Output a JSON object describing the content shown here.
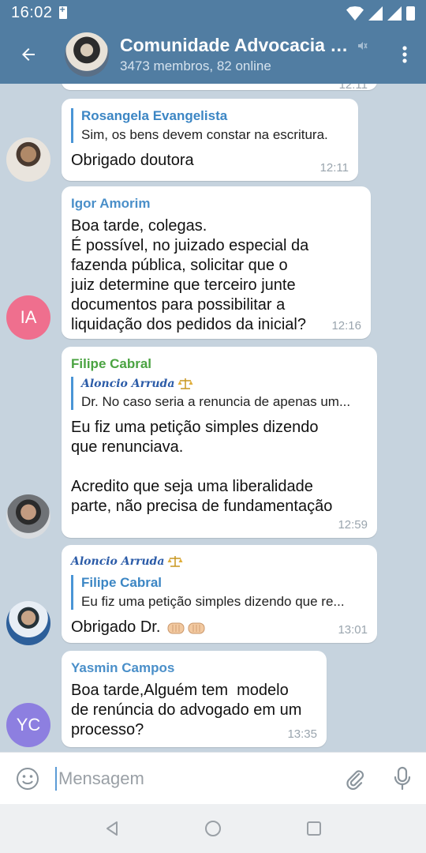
{
  "status_bar": {
    "time": "16:02"
  },
  "header": {
    "title": "Comunidade Advocacia d...",
    "subtitle": "3473 membros, 82 online"
  },
  "messages": {
    "top_partial": {
      "time": "12:11"
    },
    "m1": {
      "reply_name": "Rosangela Evangelista",
      "reply_text": "Sim, os bens devem constar na escritura.",
      "text": "Obrigado doutora",
      "time": "12:11"
    },
    "m2": {
      "sender": "Igor Amorim",
      "sender_color": "#4a8fc9",
      "avatar_initials": "IA",
      "avatar_color": "#ef6f8e",
      "text": "Boa tarde, colegas.\nÉ possível, no juizado especial da\nfazenda pública, solicitar que o\njuiz determine que terceiro junte\ndocumentos para possibilitar a\nliquidação dos pedidos da inicial?",
      "time": "12:16"
    },
    "m3": {
      "sender": "Filipe Cabral",
      "sender_color": "#4aa341",
      "reply_name": "Aloncio Arruda",
      "reply_text": "Dr. No caso seria a renuncia de apenas um...",
      "text": "Eu fiz uma petição simples dizendo\nque renunciava.\n\nAcredito que seja uma liberalidade\nparte, não precisa de fundamentação",
      "time": "12:59"
    },
    "m4": {
      "sender_signature": "Aloncio Arruda",
      "reply_name": "Filipe Cabral",
      "reply_text": "Eu fiz uma petição simples dizendo que re...",
      "text": "Obrigado Dr.",
      "time": "13:01"
    },
    "m5": {
      "sender": "Yasmin Campos",
      "sender_color": "#4a8fc9",
      "avatar_initials": "YC",
      "avatar_color": "#8d7fe0",
      "text": "Boa tarde,Alguém tem  modelo\nde renúncia do advogado em um\nprocesso?",
      "time": "13:35"
    }
  },
  "input": {
    "placeholder": "Mensagem"
  }
}
